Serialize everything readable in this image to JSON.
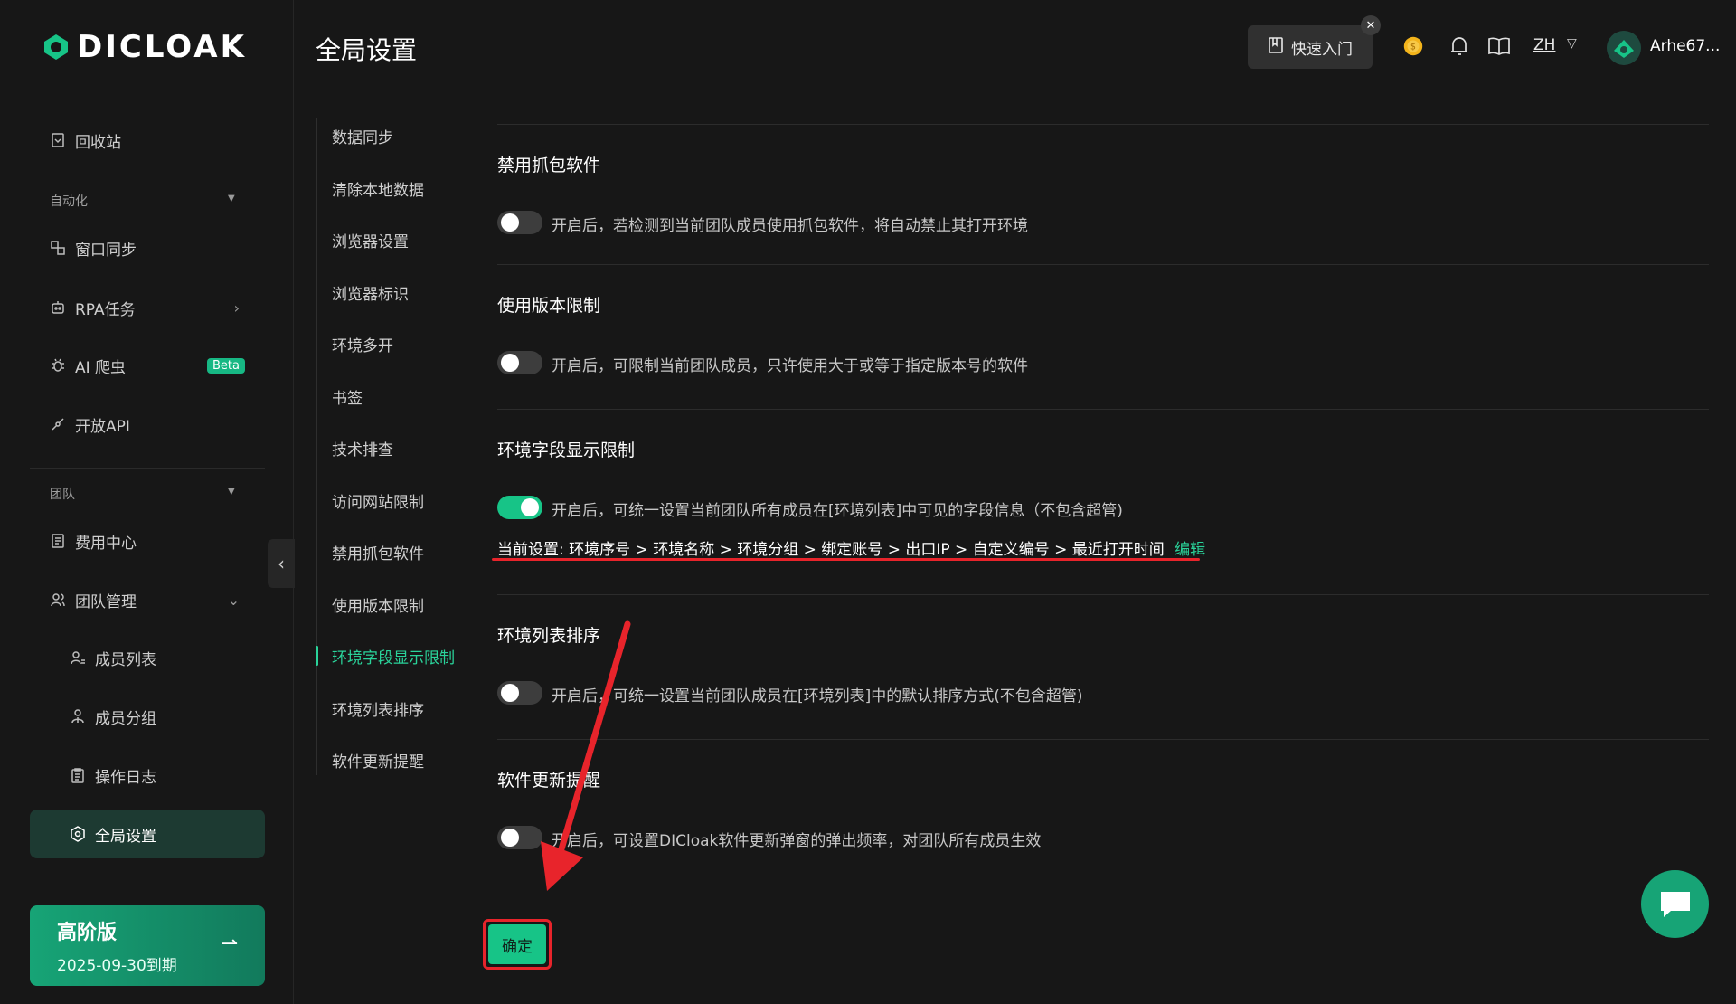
{
  "brand": {
    "logo_text": "DICLOAK",
    "accent": "#17c487"
  },
  "header": {
    "page_title": "全局设置",
    "quick_start_label": "快速入门",
    "language": "ZH",
    "username": "Arhe67..."
  },
  "sidebar": {
    "recycle_bin": "回收站",
    "section_automation": "自动化",
    "window_sync": "窗口同步",
    "rpa_tasks": "RPA任务",
    "ai_crawler": "AI 爬虫",
    "beta": "Beta",
    "open_api": "开放API",
    "section_team": "团队",
    "billing_center": "费用中心",
    "team_management": "团队管理",
    "member_list": "成员列表",
    "member_groups": "成员分组",
    "operation_logs": "操作日志",
    "global_settings": "全局设置",
    "plan": {
      "title": "高阶版",
      "expiry": "2025-09-30到期"
    }
  },
  "subnav": {
    "items": [
      "数据同步",
      "清除本地数据",
      "浏览器设置",
      "浏览器标识",
      "环境多开",
      "书签",
      "技术排查",
      "访问网站限制",
      "禁用抓包软件",
      "使用版本限制",
      "环境字段显示限制",
      "环境列表排序",
      "软件更新提醒"
    ],
    "active_index": 10
  },
  "settings": {
    "disable_capture": {
      "title": "禁用抓包软件",
      "desc": "开启后，若检测到当前团队成员使用抓包软件，将自动禁止其打开环境",
      "enabled": false
    },
    "version_limit": {
      "title": "使用版本限制",
      "desc": "开启后，可限制当前团队成员，只许使用大于或等于指定版本号的软件",
      "enabled": false
    },
    "field_display": {
      "title": "环境字段显示限制",
      "desc": "开启后，可统一设置当前团队所有成员在[环境列表]中可见的字段信息（不包含超管)",
      "enabled": true,
      "current_label": "当前设置:",
      "current_value": "环境序号 > 环境名称 > 环境分组 > 绑定账号 > 出口IP > 自定义编号 > 最近打开时间",
      "edit_label": "编辑"
    },
    "list_sort": {
      "title": "环境列表排序",
      "desc": "开启后，可统一设置当前团队成员在[环境列表]中的默认排序方式(不包含超管)",
      "enabled": false
    },
    "update_reminder": {
      "title": "软件更新提醒",
      "desc": "开启后，可设置DICloak软件更新弹窗的弹出频率，对团队所有成员生效",
      "enabled": false
    }
  },
  "confirm_label": "确定"
}
